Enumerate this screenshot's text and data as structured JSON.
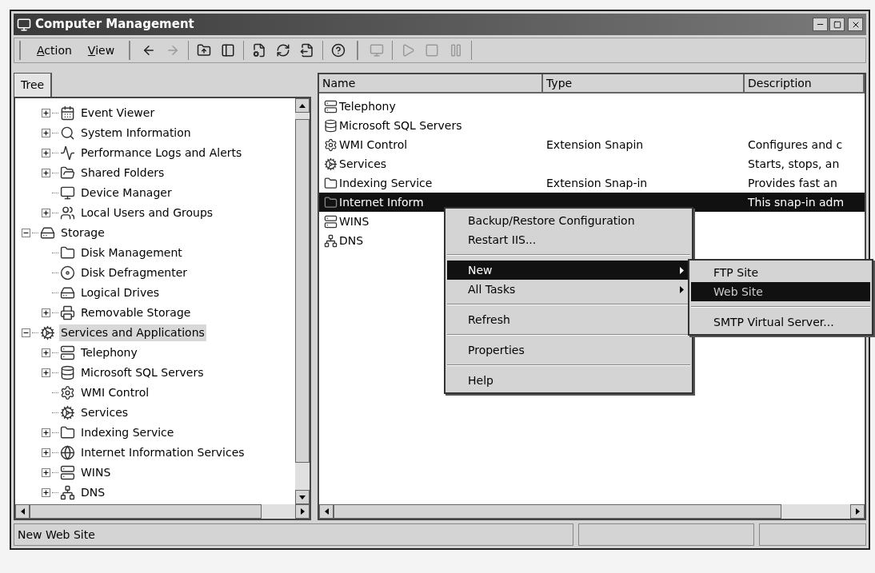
{
  "window": {
    "title": "Computer Management"
  },
  "menu_bar": [
    {
      "label": "Action"
    },
    {
      "label": "View"
    }
  ],
  "tree_tab": {
    "label": "Tree",
    "selected": true
  },
  "tree": {
    "continued": [
      {
        "label": "Event Viewer",
        "has_expander": true,
        "expanded": false,
        "selected": false
      },
      {
        "label": "System Information",
        "has_expander": true,
        "expanded": false,
        "selected": false
      },
      {
        "label": "Performance Logs and Alerts",
        "has_expander": true,
        "expanded": false,
        "selected": false
      },
      {
        "label": "Shared Folders",
        "has_expander": true,
        "expanded": false,
        "selected": false
      },
      {
        "label": "Device Manager",
        "has_expander": false,
        "selected": false
      },
      {
        "label": "Local Users and Groups",
        "has_expander": true,
        "expanded": false,
        "selected": false
      }
    ],
    "items": [
      {
        "label": "Storage",
        "has_expander": true,
        "expanded": true,
        "selected": false,
        "children": [
          {
            "label": "Disk Management",
            "has_expander": false,
            "selected": false
          },
          {
            "label": "Disk Defragmenter",
            "has_expander": false,
            "selected": false
          },
          {
            "label": "Logical Drives",
            "has_expander": false,
            "selected": false
          },
          {
            "label": "Removable Storage",
            "has_expander": true,
            "expanded": false,
            "selected": false
          }
        ]
      },
      {
        "label": "Services and Applications",
        "has_expander": true,
        "expanded": true,
        "selected": true,
        "children": [
          {
            "label": "Telephony",
            "has_expander": true,
            "expanded": false,
            "selected": false
          },
          {
            "label": "Microsoft SQL Servers",
            "has_expander": true,
            "expanded": false,
            "selected": false
          },
          {
            "label": "WMI Control",
            "has_expander": false,
            "selected": false
          },
          {
            "label": "Services",
            "has_expander": false,
            "selected": false
          },
          {
            "label": "Indexing Service",
            "has_expander": true,
            "expanded": false,
            "selected": false
          },
          {
            "label": "Internet Information Services",
            "has_expander": true,
            "expanded": false,
            "selected": false
          },
          {
            "label": "WINS",
            "has_expander": true,
            "expanded": false,
            "selected": false
          },
          {
            "label": "DNS",
            "has_expander": true,
            "expanded": false,
            "selected": false
          }
        ]
      }
    ]
  },
  "list": {
    "columns": [
      "Name",
      "Type",
      "Description"
    ],
    "rows": [
      {
        "name": "Telephony",
        "selected": false
      },
      {
        "name": "Microsoft SQL Servers",
        "selected": false
      },
      {
        "name": "WMI Control",
        "type": "Extension Snapin",
        "description": "Configures and c",
        "selected": false
      },
      {
        "name": "Services",
        "description": "Starts, stops, an",
        "selected": false
      },
      {
        "name": "Indexing Service",
        "type": "Extension Snap-in",
        "description": "Provides fast an",
        "selected": false
      },
      {
        "name": "Internet Inform",
        "description": "This snap-in adm",
        "selected": true
      },
      {
        "name": "WINS",
        "selected": false
      },
      {
        "name": "DNS",
        "selected": false
      }
    ]
  },
  "context_menu": [
    {
      "kind": "item",
      "label": "Backup/Restore Configuration",
      "submenu": false,
      "selected": false
    },
    {
      "kind": "item",
      "label": "Restart IIS...",
      "submenu": false,
      "selected": false
    },
    {
      "kind": "separator"
    },
    {
      "kind": "item",
      "label": "New",
      "submenu": true,
      "selected": true
    },
    {
      "kind": "item",
      "label": "All Tasks",
      "submenu": true,
      "selected": false
    },
    {
      "kind": "separator"
    },
    {
      "kind": "item",
      "label": "Refresh",
      "submenu": false,
      "selected": false
    },
    {
      "kind": "separator"
    },
    {
      "kind": "item",
      "label": "Properties",
      "submenu": false,
      "selected": false
    },
    {
      "kind": "separator"
    },
    {
      "kind": "item",
      "label": "Help",
      "submenu": false,
      "selected": false
    }
  ],
  "submenu": [
    {
      "kind": "item",
      "label": "FTP Site",
      "selected": false
    },
    {
      "kind": "item",
      "label": "Web Site",
      "selected": true
    },
    {
      "kind": "separator"
    },
    {
      "kind": "item",
      "label": "SMTP Virtual Server...",
      "selected": false
    }
  ],
  "status_bar": {
    "text": "New Web Site"
  }
}
